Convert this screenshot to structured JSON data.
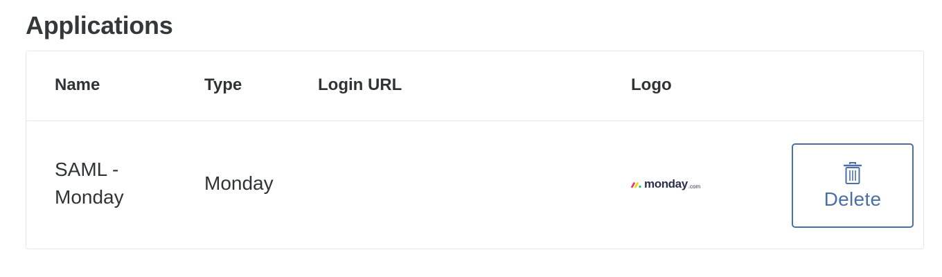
{
  "page": {
    "title": "Applications"
  },
  "table": {
    "columns": [
      "Name",
      "Type",
      "Login URL",
      "Logo"
    ],
    "rows": [
      {
        "name": "SAML - Monday",
        "type": "Monday",
        "login_url": "",
        "logo": {
          "wordmark": "monday",
          "suffix": ".com",
          "icon": "monday-logo-icon"
        },
        "action": {
          "label": "Delete",
          "icon": "trash-icon"
        }
      }
    ]
  },
  "colors": {
    "accent": "#4a6fa5",
    "text": "#2f3336",
    "border": "#e3e6ea",
    "logo_red": "#f62b54",
    "logo_yellow": "#ffcc00",
    "logo_green": "#00ca72"
  }
}
